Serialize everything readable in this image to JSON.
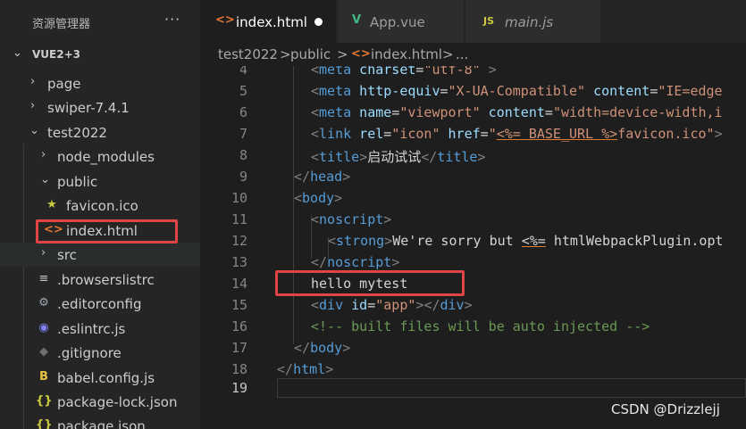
{
  "explorer": {
    "title": "资源管理器",
    "more": "···",
    "project": "VUE2+3",
    "items": [
      {
        "label": "page",
        "icon": "chevron-right-icon"
      },
      {
        "label": "swiper-7.4.1",
        "icon": "chevron-right-icon"
      },
      {
        "label": "test2022",
        "icon": "chevron-down-icon"
      },
      {
        "label": "node_modules",
        "icon": "chevron-right-icon"
      },
      {
        "label": "public",
        "icon": "chevron-down-icon"
      },
      {
        "label": "favicon.ico",
        "icon": "star-icon"
      },
      {
        "label": "index.html",
        "icon": "html-icon"
      },
      {
        "label": "src",
        "icon": "chevron-right-icon"
      },
      {
        "label": ".browserslistrc",
        "icon": "lines-icon"
      },
      {
        "label": ".editorconfig",
        "icon": "gear-icon"
      },
      {
        "label": ".eslintrc.js",
        "icon": "eslint-icon"
      },
      {
        "label": ".gitignore",
        "icon": "git-icon"
      },
      {
        "label": "babel.config.js",
        "icon": "babel-icon"
      },
      {
        "label": "package-lock.json",
        "icon": "json-icon"
      },
      {
        "label": "package.json",
        "icon": "json-icon"
      }
    ]
  },
  "tabs": [
    {
      "label": "index.html",
      "glyph": "<>",
      "active": true,
      "modified": true
    },
    {
      "label": "App.vue",
      "glyph": "V",
      "active": false
    },
    {
      "label": "main.js",
      "glyph": "JS",
      "active": false
    }
  ],
  "breadcrumb": {
    "part1": "test2022",
    "sep1": ">",
    "part2": "public",
    "sep2": ">",
    "icon": "<>",
    "part3": "index.html",
    "sep3": ">",
    "part4": "..."
  },
  "editor": {
    "line_numbers": [
      "4",
      "5",
      "6",
      "7",
      "8",
      "9",
      "10",
      "11",
      "12",
      "13",
      "14",
      "15",
      "16",
      "17",
      "18",
      "19"
    ],
    "current_line": "19",
    "lines": {
      "l4": {
        "open": "<",
        "tag": "meta",
        "attr": " charset",
        "eq": "=",
        "val": "\"utf-8\"",
        "close": ">"
      },
      "l5": {
        "open": "<",
        "tag": "meta",
        "attr1": " http-equiv",
        "eq1": "=",
        "val1": "\"X-UA-Compatible\"",
        "attr2": " content",
        "eq2": "=",
        "val2": "\"IE=edge"
      },
      "l6": {
        "open": "<",
        "tag": "meta",
        "attr1": " name",
        "eq1": "=",
        "val1": "\"viewport\"",
        "attr2": " content",
        "eq2": "=",
        "val2": "\"width=device-width,i"
      },
      "l7": {
        "open": "<",
        "tag": "link",
        "attr1": " rel",
        "eq1": "=",
        "val1": "\"icon\"",
        "attr2": " href",
        "eq2": "=",
        "q1": "\"",
        "tpl": "<%= BASE_URL %>",
        "rest": "favicon.ico",
        "q2": "\"",
        "close": ">"
      },
      "l8": {
        "open": "<",
        "tag": "title",
        "close": ">",
        "text": "启动试试",
        "open2": "</",
        "tag2": "title",
        "close2": ">"
      },
      "l9": {
        "open": "</",
        "tag": "head",
        "close": ">"
      },
      "l10": {
        "open": "<",
        "tag": "body",
        "close": ">"
      },
      "l11": {
        "open": "<",
        "tag": "noscript",
        "close": ">"
      },
      "l12": {
        "open": "<",
        "tag": "strong",
        "close": ">",
        "text": "We're sorry but ",
        "tpl": "<%=",
        "rest": " htmlWebpackPlugin.opt"
      },
      "l13": {
        "open": "</",
        "tag": "noscript",
        "close": ">"
      },
      "l14": {
        "text": "hello mytest"
      },
      "l15": {
        "open": "<",
        "tag": "div",
        "attr": " id",
        "eq": "=",
        "val": "\"app\"",
        "close": ">",
        "open2": "</",
        "tag2": "div",
        "close2": ">"
      },
      "l16": {
        "text": "<!-- built files will be auto injected -->"
      },
      "l17": {
        "open": "</",
        "tag": "body",
        "close": ">"
      },
      "l18": {
        "open": "</",
        "tag": "html",
        "close": ">"
      }
    }
  },
  "watermark": "CSDN @Drizzlejj",
  "colors": {
    "highlight": "#e04545",
    "html_icon": "#e37933",
    "vue_icon": "#42b883",
    "js_icon": "#cbcb41"
  }
}
